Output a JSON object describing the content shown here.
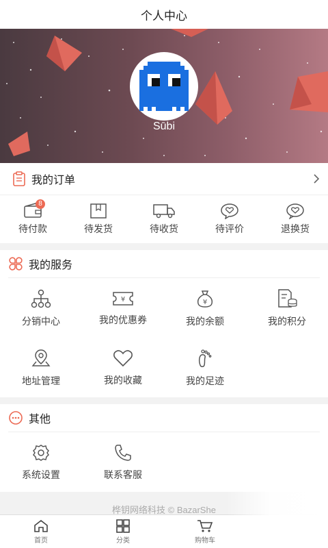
{
  "header": {
    "title": "个人中心"
  },
  "profile": {
    "username": "Sūbi",
    "avatar_icon": "pacman-ghost-icon"
  },
  "orders": {
    "title": "我的订单",
    "items": [
      {
        "label": "待付款",
        "icon": "wallet-icon",
        "badge": "8"
      },
      {
        "label": "待发货",
        "icon": "package-icon"
      },
      {
        "label": "待收货",
        "icon": "truck-icon"
      },
      {
        "label": "待评价",
        "icon": "comment-heart-icon"
      },
      {
        "label": "退换货",
        "icon": "return-heart-icon"
      }
    ]
  },
  "services": {
    "title": "我的服务",
    "items": [
      {
        "label": "分销中心",
        "icon": "network-icon"
      },
      {
        "label": "我的优惠券",
        "icon": "coupon-icon"
      },
      {
        "label": "我的余额",
        "icon": "money-bag-icon"
      },
      {
        "label": "我的积分",
        "icon": "points-icon"
      },
      {
        "label": "地址管理",
        "icon": "location-icon"
      },
      {
        "label": "我的收藏",
        "icon": "heart-icon"
      },
      {
        "label": "我的足迹",
        "icon": "footprint-icon"
      }
    ]
  },
  "others": {
    "title": "其他",
    "items": [
      {
        "label": "系统设置",
        "icon": "gear-icon"
      },
      {
        "label": "联系客服",
        "icon": "phone-icon"
      }
    ]
  },
  "footer": {
    "text": "桦钥网络科技 © BazarShe"
  },
  "tabbar": {
    "items": [
      {
        "label": "首页",
        "icon": "home-icon"
      },
      {
        "label": "分类",
        "icon": "grid-icon"
      },
      {
        "label": "购物车",
        "icon": "cart-icon"
      }
    ]
  },
  "colors": {
    "accent": "#ec6a54",
    "icon_gray": "#555555",
    "ghost_blue": "#1a6fe0"
  }
}
